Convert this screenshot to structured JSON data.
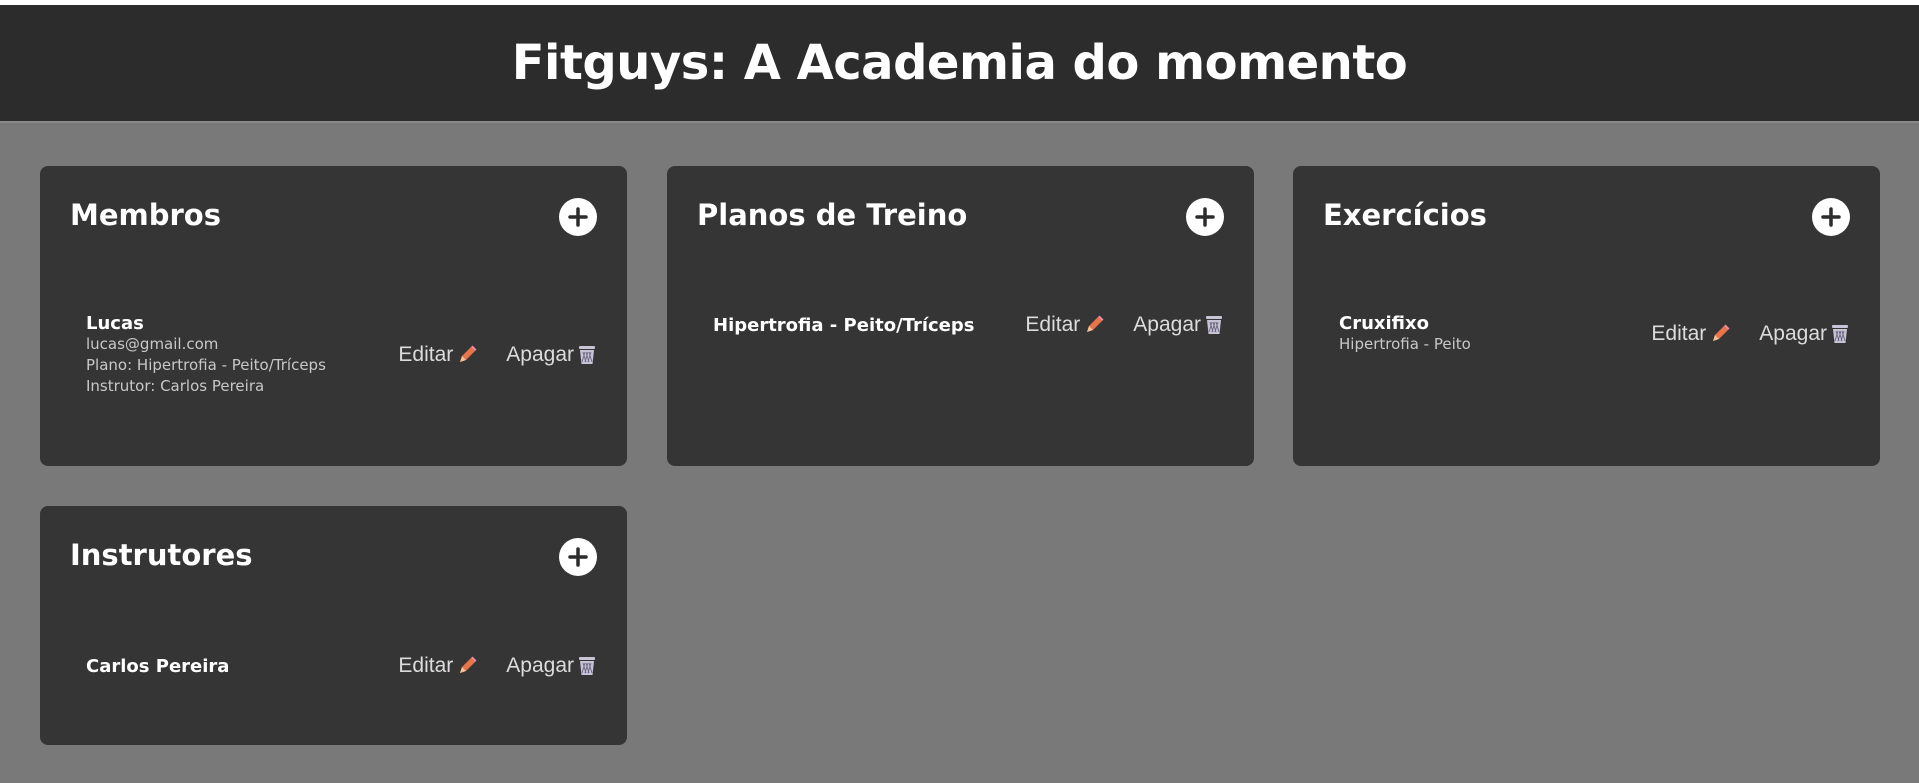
{
  "header": {
    "title": "Fitguys: A Academia do momento"
  },
  "actions": {
    "edit": "Editar",
    "delete": "Apagar"
  },
  "colors": {
    "edit_icon": "#e8754a",
    "delete_icon": "#c9c3d6"
  },
  "cards": {
    "membros": {
      "title": "Membros",
      "items": [
        {
          "name": "Lucas",
          "email": "lucas@gmail.com",
          "plano": "Plano: Hipertrofia - Peito/Tríceps",
          "instrutor": "Instrutor: Carlos Pereira"
        }
      ]
    },
    "planos": {
      "title": "Planos de Treino",
      "items": [
        {
          "name": "Hipertrofia - Peito/Tríceps"
        }
      ]
    },
    "exercicios": {
      "title": "Exercícios",
      "items": [
        {
          "name": "Cruxifixo",
          "detail": "Hipertrofia - Peito"
        }
      ]
    },
    "instrutores": {
      "title": "Instrutores",
      "items": [
        {
          "name": "Carlos Pereira"
        }
      ]
    }
  }
}
